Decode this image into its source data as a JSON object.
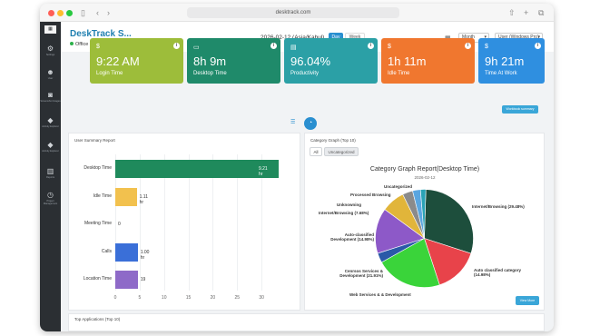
{
  "browser": {
    "url": "desktrack.com",
    "colors": {
      "close": "#ff5f57",
      "minimize": "#febc2e",
      "maximize": "#28c840"
    }
  },
  "sidebar": {
    "items": [
      {
        "icon": "logo-icon",
        "label": ""
      },
      {
        "icon": "gear-icon",
        "label": "Settings"
      },
      {
        "icon": "users-icon",
        "label": "User"
      },
      {
        "icon": "camera-icon",
        "label": "Screenshot Images"
      },
      {
        "icon": "tag-icon",
        "label": "Activity Explorer"
      },
      {
        "icon": "tag-icon",
        "label": "Activity Explorer"
      },
      {
        "icon": "bar-chart-icon",
        "label": "Reports"
      },
      {
        "icon": "clock-icon",
        "label": "Project Management"
      }
    ]
  },
  "header": {
    "title": "DeskTrack S...",
    "status": "Office",
    "date": "2026-02-12 (Asia/Kabul)",
    "day_label": "Day",
    "week_label": "Week",
    "period_select": "Month",
    "user_select": "User (Windows Pro)"
  },
  "cards": [
    {
      "value": "9:22 AM",
      "label": "Login Time",
      "color": "#9dbd3a",
      "icon": "dollar-icon"
    },
    {
      "value": "8h 9m",
      "label": "Desktop Time",
      "color": "#1f8a6a",
      "icon": "monitor-icon"
    },
    {
      "value": "96.04%",
      "label": "Productivity",
      "color": "#2ba0a6",
      "icon": "clipboard-icon"
    },
    {
      "value": "1h 11m",
      "label": "Idle Time",
      "color": "#f0772f",
      "icon": "dollar-icon"
    },
    {
      "value": "9h 21m",
      "label": "Time At Work",
      "color": "#2f8fe0",
      "icon": "dollar-icon"
    }
  ],
  "actions": {
    "wide_button": "Workbook summary",
    "view_more": "View More"
  },
  "user_summary": {
    "title": "User Summary Report",
    "chart_data": {
      "type": "bar",
      "orientation": "horizontal",
      "categories": [
        "Desktop Time",
        "Idle Time",
        "Meeting Time",
        "Calls",
        "Location Time"
      ],
      "value_labels": [
        "9.21 hr",
        "1.11 hr",
        "0",
        "1.00 hr",
        "19"
      ],
      "values": [
        33.5,
        4.4,
        0,
        4.6,
        4.6
      ],
      "xticks": [
        "0",
        "5",
        "10",
        "15",
        "20",
        "25",
        "30"
      ],
      "xlim": [
        0,
        35
      ],
      "colors": [
        "#1f8a5c",
        "#f2c14e",
        "#999999",
        "#3a6fd8",
        "#8e6ac8"
      ]
    }
  },
  "category_graph": {
    "title": "Category Graph (Top 10)",
    "tabs": [
      "All",
      "Uncategorized"
    ],
    "chart_data": {
      "type": "pie",
      "title": "Category Graph Report(Desktop Time)",
      "subtitle": "2026-02-12",
      "slices": [
        {
          "label": "Internet/Browsing (29.48%)",
          "value": 29.48,
          "color": "#1d4e3c"
        },
        {
          "label": "Auto classified category (14.98%)",
          "value": 14.98,
          "color": "#e8434a"
        },
        {
          "label": "Web Services & & Development",
          "value": 21.91,
          "color": "#3ad43a"
        },
        {
          "label": "Cenrsos Services & Development (21.91%)",
          "value": 3.2,
          "color": "#2a59a8"
        },
        {
          "label": "Auto-classified Development (14.98%)",
          "value": 14.98,
          "color": "#8d59c8"
        },
        {
          "label": "Internet/Browsing (7.68%)",
          "value": 7.68,
          "color": "#e1b53a"
        },
        {
          "label": "Unknowning",
          "value": 3.4,
          "color": "#8b8b8b"
        },
        {
          "label": "Processed Browsing",
          "value": 2.6,
          "color": "#5aa6e0"
        },
        {
          "label": "Uncategorized",
          "value": 1.77,
          "color": "#2aa3b5"
        }
      ]
    }
  },
  "top_apps": {
    "title": "Top Applications (Top 10)"
  }
}
